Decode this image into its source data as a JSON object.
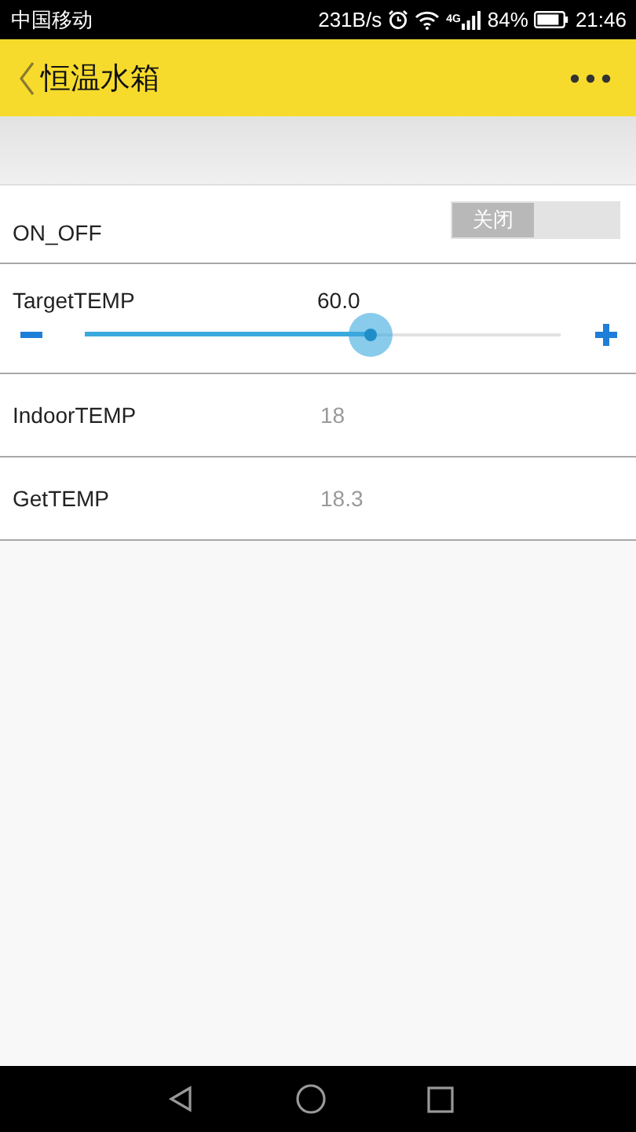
{
  "status_bar": {
    "carrier": "中国移动",
    "speed": "231B/s",
    "network": "4G",
    "battery": "84%",
    "time": "21:46"
  },
  "header": {
    "title": "恒温水箱"
  },
  "rows": [
    {
      "kind": "switch",
      "label": "ON_OFF",
      "switch": {
        "label": "关闭",
        "on": false
      }
    },
    {
      "kind": "slider",
      "label": "TargetTEMP",
      "value": "60.0",
      "level": 0.6
    },
    {
      "kind": "reading",
      "label": "IndoorTEMP",
      "value": "18"
    },
    {
      "kind": "reading",
      "label": "GetTEMP",
      "value": "18.3"
    }
  ]
}
